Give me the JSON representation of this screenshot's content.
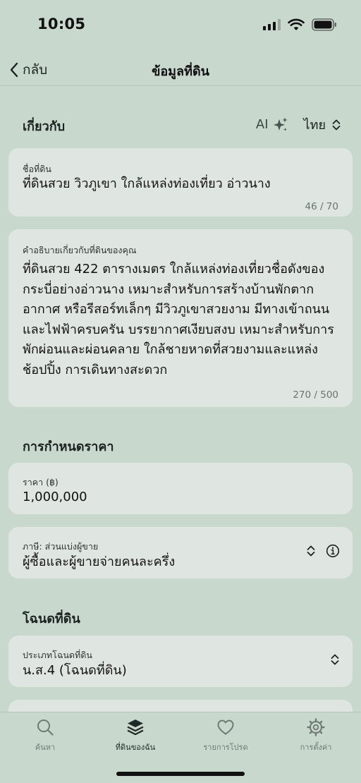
{
  "status_bar": {
    "time": "10:05"
  },
  "nav": {
    "back_label": "กลับ",
    "title": "ข้อมูลที่ดิน"
  },
  "about": {
    "header": "เกี่ยวกับ",
    "ai_label": "AI",
    "language": "ไทย",
    "land_name": {
      "label": "ชื่อที่ดิน",
      "value": "ที่ดินสวย วิวภูเขา ใกล้แหล่งท่องเที่ยว อ่าวนาง",
      "counter": "46 / 70"
    },
    "description": {
      "label": "คำอธิบายเกี่ยวกับที่ดินของคุณ",
      "value": "ที่ดินสวย 422 ตารางเมตร ใกล้แหล่งท่องเที่ยวชื่อดังของกระบี่อย่างอ่าวนาง เหมาะสำหรับการสร้างบ้านพักตากอากาศ หรือรีสอร์ทเล็กๆ มีวิวภูเขาสวยงาม มีทางเข้าถนนและไฟฟ้าครบครัน บรรยากาศเงียบสงบ เหมาะสำหรับการพักผ่อนและผ่อนคลาย ใกล้ชายหาดที่สวยงามและแหล่งช้อปปิ้ง การเดินทางสะดวก",
      "counter": "270 / 500"
    }
  },
  "pricing": {
    "header": "การกำหนดราคา",
    "price": {
      "label": "ราคา (฿)",
      "value": "1,000,000"
    },
    "tax": {
      "label": "ภาษี: ส่วนแบ่งผู้ขาย",
      "value": "ผู้ซื้อและผู้ขายจ่ายคนละครึ่ง"
    }
  },
  "deed": {
    "header": "โฉนดที่ดิน",
    "type": {
      "label": "ประเภทโฉนดที่ดิน",
      "value": "น.ส.4 (โฉนดที่ดิน)"
    }
  },
  "tab_bar": {
    "tabs": [
      {
        "label": "ค้นหา",
        "icon": "search-icon",
        "active": false
      },
      {
        "label": "ที่ดินของฉัน",
        "icon": "layers-icon",
        "active": true
      },
      {
        "label": "รายการโปรด",
        "icon": "heart-icon",
        "active": false
      },
      {
        "label": "การตั้งค่า",
        "icon": "gear-icon",
        "active": false
      }
    ]
  }
}
